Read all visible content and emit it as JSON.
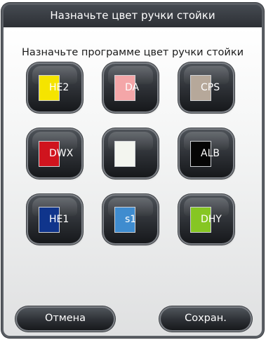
{
  "dialog": {
    "title": "Назначьте цвет ручки стойки",
    "instruction": "Назначьте программе цвет ручки стойки"
  },
  "color_buttons": [
    {
      "label": "HE2",
      "color": "#f5e400"
    },
    {
      "label": "DA",
      "color": "#f4a6a8"
    },
    {
      "label": "CPS",
      "color": "#b6a89a"
    },
    {
      "label": "DWX",
      "color": "#d0141e"
    },
    {
      "label": "",
      "color": "#f3f5ef"
    },
    {
      "label": "ALB",
      "color": "#050505"
    },
    {
      "label": "HE1",
      "color": "#10358c"
    },
    {
      "label": "s1",
      "color": "#3f8ccf"
    },
    {
      "label": "DHY",
      "color": "#86c623"
    }
  ],
  "footer": {
    "cancel_label": "Отмена",
    "save_label": "Сохран."
  },
  "colors": {
    "frame": "#5b5f65",
    "title_bar": "#2b2e33",
    "button_dark": "#2c2f34"
  }
}
